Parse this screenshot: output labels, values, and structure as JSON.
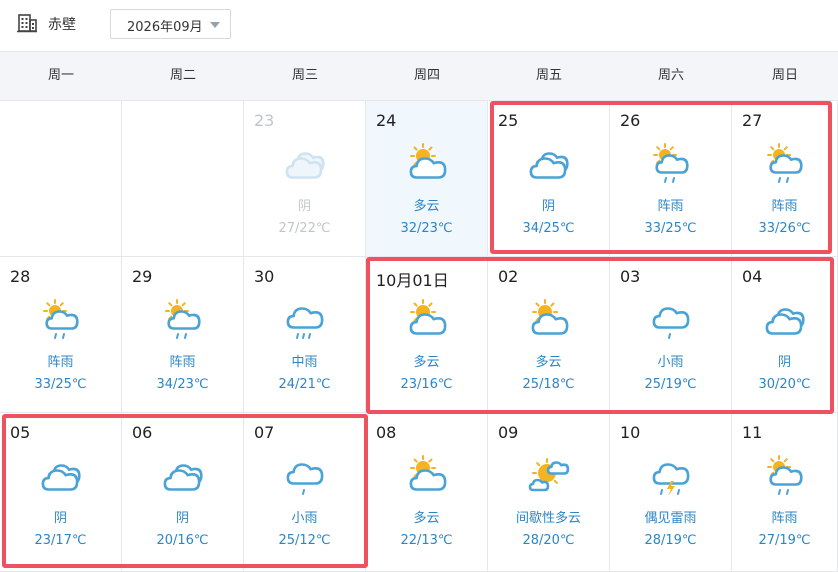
{
  "header": {
    "city": "赤壁",
    "city_icon": "building-icon",
    "month_value": "2026年09月",
    "month_caret_icon": "caret-down-icon"
  },
  "weekdays": [
    "周一",
    "周二",
    "周三",
    "周四",
    "周五",
    "周六",
    "周日"
  ],
  "colors": {
    "accent_text": "#2b86c6",
    "highlight_border": "#ee5261",
    "today_bg": "#f0f7fd",
    "cloud": "#4aa3d6",
    "sun": "#f5b320"
  },
  "weeks": [
    [
      {
        "empty": true
      },
      {
        "empty": true
      },
      {
        "day": "23",
        "icon": "cloudy-icon",
        "cond": "阴",
        "temp": "27/22℃",
        "muted": true
      },
      {
        "day": "24",
        "icon": "partly-cloudy-icon",
        "cond": "多云",
        "temp": "32/23℃",
        "today": true
      },
      {
        "day": "25",
        "icon": "cloudy-icon",
        "cond": "阴",
        "temp": "34/25℃"
      },
      {
        "day": "26",
        "icon": "shower-icon",
        "cond": "阵雨",
        "temp": "33/25℃"
      },
      {
        "day": "27",
        "icon": "shower-icon",
        "cond": "阵雨",
        "temp": "33/26℃"
      }
    ],
    [
      {
        "day": "28",
        "icon": "shower-icon",
        "cond": "阵雨",
        "temp": "33/25℃"
      },
      {
        "day": "29",
        "icon": "shower-icon",
        "cond": "阵雨",
        "temp": "34/23℃"
      },
      {
        "day": "30",
        "icon": "moderate-rain-icon",
        "cond": "中雨",
        "temp": "24/21℃"
      },
      {
        "day": "10月01日",
        "icon": "partly-cloudy-icon",
        "cond": "多云",
        "temp": "23/16℃"
      },
      {
        "day": "02",
        "icon": "partly-cloudy-icon",
        "cond": "多云",
        "temp": "25/18℃"
      },
      {
        "day": "03",
        "icon": "light-rain-icon",
        "cond": "小雨",
        "temp": "25/19℃"
      },
      {
        "day": "04",
        "icon": "cloudy-icon",
        "cond": "阴",
        "temp": "30/20℃"
      }
    ],
    [
      {
        "day": "05",
        "icon": "cloudy-icon",
        "cond": "阴",
        "temp": "23/17℃"
      },
      {
        "day": "06",
        "icon": "cloudy-icon",
        "cond": "阴",
        "temp": "20/16℃"
      },
      {
        "day": "07",
        "icon": "light-rain-icon",
        "cond": "小雨",
        "temp": "25/12℃"
      },
      {
        "day": "08",
        "icon": "partly-cloudy-icon",
        "cond": "多云",
        "temp": "22/13℃"
      },
      {
        "day": "09",
        "icon": "intermittent-cloudy-icon",
        "cond": "间歇性多云",
        "temp": "28/20℃"
      },
      {
        "day": "10",
        "icon": "thunder-shower-icon",
        "cond": "偶见雷雨",
        "temp": "28/19℃"
      },
      {
        "day": "11",
        "icon": "shower-icon",
        "cond": "阵雨",
        "temp": "27/19℃"
      }
    ]
  ]
}
